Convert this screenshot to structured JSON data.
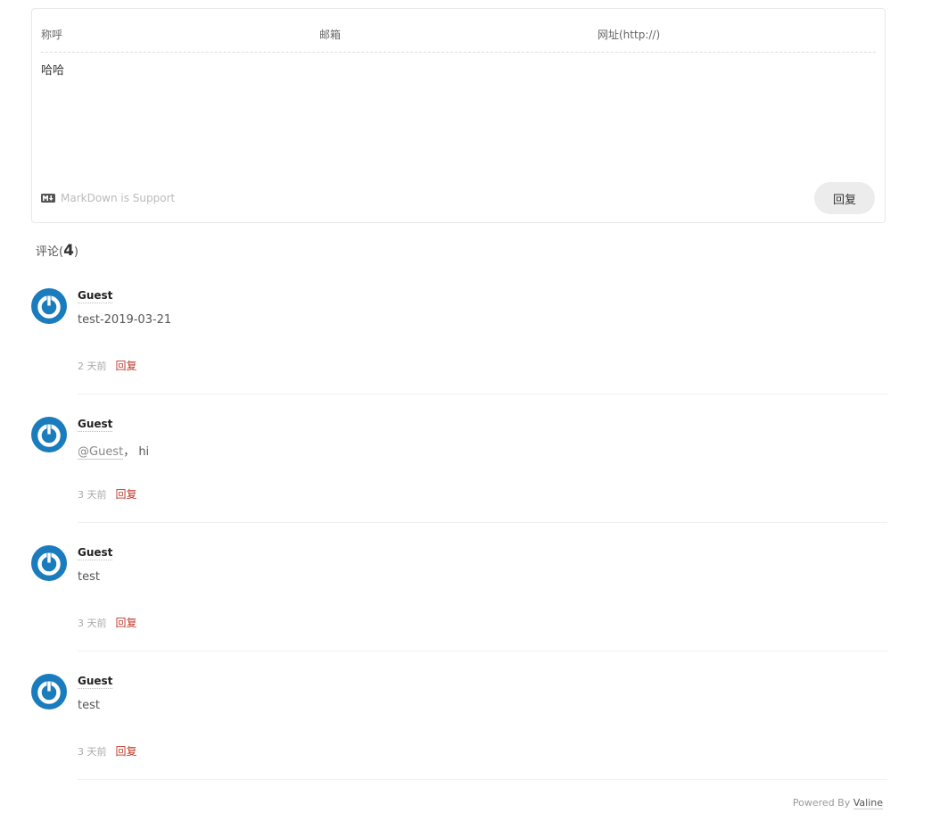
{
  "editor": {
    "nick_placeholder": "称呼",
    "mail_placeholder": "邮箱",
    "link_placeholder": "网址(http://)",
    "content_value": "哈哈",
    "markdown_note": "MarkDown is Support",
    "submit_label": "回复"
  },
  "count": {
    "prefix": "评论(",
    "number": "4",
    "suffix": ")"
  },
  "comments": [
    {
      "nick": "Guest",
      "content": "test-2019-03-21",
      "time": "2 天前",
      "reply": "回复"
    },
    {
      "nick": "Guest",
      "at": "@Guest",
      "content_rest": "， hi",
      "time": "3 天前",
      "reply": "回复"
    },
    {
      "nick": "Guest",
      "content": "test",
      "time": "3 天前",
      "reply": "回复"
    },
    {
      "nick": "Guest",
      "content": "test",
      "time": "3 天前",
      "reply": "回复"
    }
  ],
  "footer": {
    "powered_prefix": "Powered By ",
    "powered_link": "Valine"
  },
  "colors": {
    "avatar": "#1a7bbd",
    "reply": "#c0392b"
  },
  "icons": {
    "markdown": "markdown-icon",
    "avatar": "power-avatar-icon"
  }
}
